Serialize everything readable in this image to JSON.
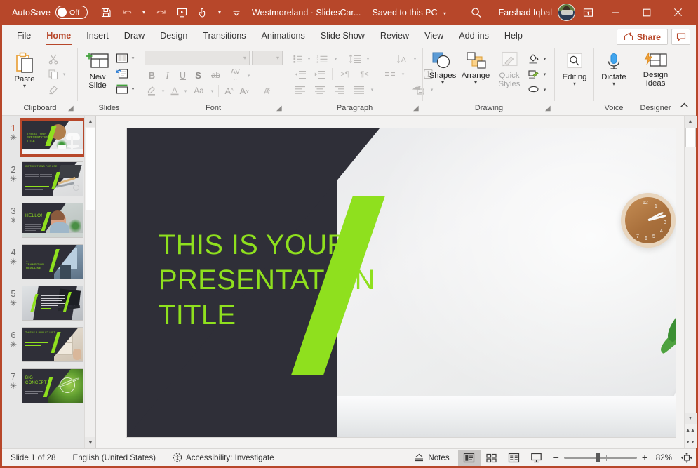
{
  "titlebar": {
    "autosave_label": "AutoSave",
    "autosave_state": "Off",
    "document_title": "Westmoreland · SlidesCar...",
    "save_state": "- Saved to this PC",
    "user_name": "Farshad Iqbal",
    "icons": {
      "save": "save-icon",
      "undo": "undo-icon",
      "redo": "redo-icon",
      "present": "start-presentation-icon",
      "touch": "touch-mode-icon",
      "more": "customize-quick-access-icon",
      "search": "search-icon",
      "ribbon_display": "ribbon-display-options-icon",
      "minimize": "minimize-icon",
      "maximize": "maximize-icon",
      "close": "close-icon"
    }
  },
  "tabs": [
    {
      "label": "File",
      "active": false
    },
    {
      "label": "Home",
      "active": true
    },
    {
      "label": "Insert",
      "active": false
    },
    {
      "label": "Draw",
      "active": false
    },
    {
      "label": "Design",
      "active": false
    },
    {
      "label": "Transitions",
      "active": false
    },
    {
      "label": "Animations",
      "active": false
    },
    {
      "label": "Slide Show",
      "active": false
    },
    {
      "label": "Review",
      "active": false
    },
    {
      "label": "View",
      "active": false
    },
    {
      "label": "Add-ins",
      "active": false
    },
    {
      "label": "Help",
      "active": false
    }
  ],
  "tabbar_right": {
    "share_label": "Share",
    "comment_label": "comments-icon"
  },
  "ribbon": {
    "groups": [
      {
        "name": "Clipboard",
        "label": "Clipboard"
      },
      {
        "name": "Slides",
        "label": "Slides"
      },
      {
        "name": "Font",
        "label": "Font"
      },
      {
        "name": "Paragraph",
        "label": "Paragraph"
      },
      {
        "name": "Drawing",
        "label": "Drawing"
      },
      {
        "name": "Voice",
        "label": "Voice"
      },
      {
        "name": "Designer",
        "label": "Designer"
      }
    ],
    "clipboard": {
      "paste_label": "Paste",
      "cut_label": "cut-icon",
      "copy_label": "copy-icon",
      "format_painter_label": "format-painter-icon"
    },
    "slides": {
      "new_slide_label": "New Slide",
      "layout_label": "layout-icon",
      "reset_label": "reset-icon",
      "section_label": "section-icon"
    },
    "font": {
      "font_name_value": "",
      "font_size_value": "",
      "bold": "B",
      "italic": "I",
      "underline": "U",
      "shadow": "S",
      "strikethrough": "ab",
      "char_spacing": "AV",
      "text_highlight": "text-highlight-icon",
      "font_color": "A",
      "change_case": "Aa",
      "increase_size": "A",
      "decrease_size": "A",
      "clear_formatting": "clear-formatting-icon"
    },
    "paragraph": {
      "bullets": "bullets-icon",
      "numbering": "numbering-icon",
      "line_spacing": "line-spacing-icon",
      "text_direction": "text-direction-icon",
      "decrease_indent": "decrease-indent-icon",
      "increase_indent": "increase-indent-icon",
      "ltr": "left-to-right-icon",
      "rtl": "right-to-left-icon",
      "columns": "columns-icon",
      "align_text": "align-text-icon",
      "align_left": "align-left-icon",
      "align_center": "align-center-icon",
      "align_right": "align-right-icon",
      "justify": "justify-icon",
      "smartart": "convert-to-smartart-icon"
    },
    "drawing": {
      "shapes_label": "Shapes",
      "arrange_label": "Arrange",
      "quick_styles_label": "Quick Styles",
      "shape_fill": "shape-fill-icon",
      "shape_outline": "shape-outline-icon",
      "shape_effects": "shape-effects-icon"
    },
    "editing": {
      "label": "Editing"
    },
    "voice": {
      "dictate_label": "Dictate"
    },
    "designer": {
      "design_ideas_label": "Design Ideas"
    },
    "collapse_ribbon": "collapse-ribbon-icon"
  },
  "thumbnails": [
    {
      "number": "1",
      "selected": true,
      "kind": "title",
      "title": "THIS IS YOUR PRESENTATION TITLE"
    },
    {
      "number": "2",
      "selected": false,
      "kind": "content",
      "title": "INSTRUCTIONS FOR USE"
    },
    {
      "number": "3",
      "selected": false,
      "kind": "hello",
      "title": "HELLO!"
    },
    {
      "number": "4",
      "selected": false,
      "kind": "transition",
      "title": "1. TRANSITION HEADLINE"
    },
    {
      "number": "5",
      "selected": false,
      "kind": "quote",
      "title": "Quotations are commonly printed as a means of inspiration"
    },
    {
      "number": "6",
      "selected": false,
      "kind": "bullets",
      "title": "THIS IS A BULLET LIST"
    },
    {
      "number": "7",
      "selected": false,
      "kind": "concept",
      "title": "BIG CONCEPT"
    }
  ],
  "slide": {
    "title_lines": [
      "THIS IS YOUR",
      "PRESENTATION",
      "TITLE"
    ],
    "title_color": "#8fe01e",
    "background_color": "#2f2f38"
  },
  "statusbar": {
    "slide_counter": "Slide 1 of 28",
    "language": "English (United States)",
    "accessibility": "Accessibility: Investigate",
    "notes_label": "Notes",
    "views": [
      {
        "name": "normal-view",
        "active": true
      },
      {
        "name": "slide-sorter-view",
        "active": false
      },
      {
        "name": "reading-view",
        "active": false
      },
      {
        "name": "slide-show-view",
        "active": false
      }
    ],
    "zoom_out": "−",
    "zoom_in": "+",
    "zoom_level": "82%",
    "fit_slide": "fit-slide-to-window-icon"
  },
  "colors": {
    "brand": "#b7472a",
    "accent_green": "#8fe01e",
    "ribbon_bg": "#f3f2f1",
    "panel_bg": "#e6e6e6"
  }
}
